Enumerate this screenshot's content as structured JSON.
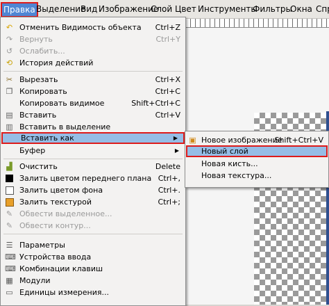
{
  "menubar": {
    "items": [
      "Правка",
      "Выделение",
      "Вид",
      "Изображение",
      "Слой",
      "Цвет",
      "Инструменты",
      "Фильтры",
      "Окна",
      "Справка"
    ]
  },
  "edit_menu": {
    "items": [
      {
        "label": "Отменить Видимость объекта",
        "shortcut": "Ctrl+Z",
        "icon": "undo-icon",
        "enabled": true
      },
      {
        "label": "Вернуть",
        "shortcut": "Ctrl+Y",
        "icon": "redo-icon",
        "enabled": false
      },
      {
        "label": "Ослабить...",
        "shortcut": "",
        "icon": "fade-icon",
        "enabled": false
      },
      {
        "label": "История действий",
        "shortcut": "",
        "icon": "history-icon",
        "enabled": true
      },
      {
        "label": "Вырезать",
        "shortcut": "Ctrl+X",
        "icon": "cut-icon",
        "enabled": true
      },
      {
        "label": "Копировать",
        "shortcut": "Ctrl+C",
        "icon": "copy-icon",
        "enabled": true
      },
      {
        "label": "Копировать видимое",
        "shortcut": "Shift+Ctrl+C",
        "icon": "",
        "enabled": true
      },
      {
        "label": "Вставить",
        "shortcut": "Ctrl+V",
        "icon": "paste-icon",
        "enabled": true
      },
      {
        "label": "Вставить в выделение",
        "shortcut": "",
        "icon": "paste-into-icon",
        "enabled": true
      },
      {
        "label": "Вставить как",
        "shortcut": "",
        "icon": "",
        "enabled": true,
        "submenu": true,
        "highlighted": true
      },
      {
        "label": "Буфер",
        "shortcut": "",
        "icon": "",
        "enabled": true,
        "submenu": true
      },
      {
        "label": "Очистить",
        "shortcut": "Delete",
        "icon": "clear-icon",
        "enabled": true
      },
      {
        "label": "Залить цветом переднего плана",
        "shortcut": "Ctrl+,",
        "icon": "fg-fill-icon",
        "enabled": true
      },
      {
        "label": "Залить цветом фона",
        "shortcut": "Ctrl+.",
        "icon": "bg-fill-icon",
        "enabled": true
      },
      {
        "label": "Залить текстурой",
        "shortcut": "Ctrl+;",
        "icon": "pattern-fill-icon",
        "enabled": true
      },
      {
        "label": "Обвести выделенное...",
        "shortcut": "",
        "icon": "stroke-selection-icon",
        "enabled": false
      },
      {
        "label": "Обвести контур...",
        "shortcut": "",
        "icon": "stroke-path-icon",
        "enabled": false
      },
      {
        "label": "Параметры",
        "shortcut": "",
        "icon": "preferences-icon",
        "enabled": true
      },
      {
        "label": "Устройства ввода",
        "shortcut": "",
        "icon": "input-devices-icon",
        "enabled": true
      },
      {
        "label": "Комбинации клавиш",
        "shortcut": "",
        "icon": "keyboard-icon",
        "enabled": true
      },
      {
        "label": "Модули",
        "shortcut": "",
        "icon": "modules-icon",
        "enabled": true
      },
      {
        "label": "Единицы измерения...",
        "shortcut": "",
        "icon": "units-icon",
        "enabled": true
      }
    ]
  },
  "paste_as_submenu": {
    "items": [
      {
        "label": "Новое изображение",
        "shortcut": "Shift+Ctrl+V",
        "icon": "new-image-icon",
        "highlighted": false
      },
      {
        "label": "Новый слой",
        "shortcut": "",
        "icon": "",
        "highlighted": true
      },
      {
        "label": "Новая кисть...",
        "shortcut": "",
        "icon": "",
        "highlighted": false
      },
      {
        "label": "Новая текстура...",
        "shortcut": "",
        "icon": "",
        "highlighted": false
      }
    ]
  },
  "colors": {
    "highlight": "#95bde6",
    "annotation_border": "#dd1b1b",
    "active_menubar": "#4f86d4"
  }
}
